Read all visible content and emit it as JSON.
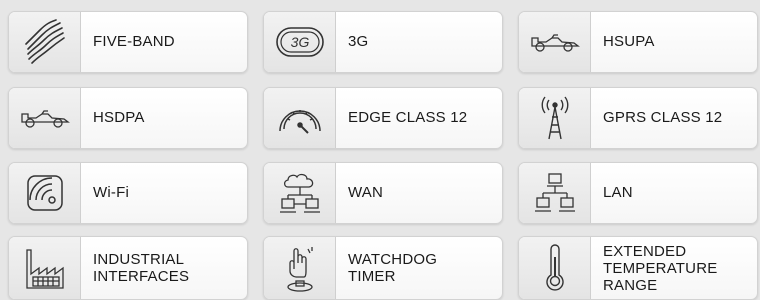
{
  "tiles": [
    {
      "label": "FIVE-BAND",
      "icon": "five-band-icon"
    },
    {
      "label": "3G",
      "icon": "3g-icon"
    },
    {
      "label": "HSUPA",
      "icon": "race-car-icon"
    },
    {
      "label": "HSDPA",
      "icon": "race-car-icon"
    },
    {
      "label": "EDGE CLASS 12",
      "icon": "speedometer-icon"
    },
    {
      "label": "GPRS CLASS 12",
      "icon": "antenna-tower-icon"
    },
    {
      "label": "Wi-Fi",
      "icon": "wifi-icon"
    },
    {
      "label": "WAN",
      "icon": "cloud-network-icon"
    },
    {
      "label": "LAN",
      "icon": "lan-network-icon"
    },
    {
      "label": "INDUSTRIAL\nINTERFACES",
      "icon": "factory-icon"
    },
    {
      "label": "WATCHDOG\nTIMER",
      "icon": "hand-button-icon"
    },
    {
      "label": "EXTENDED\nTEMPERATURE\nRANGE",
      "icon": "thermometer-icon"
    }
  ],
  "icon_text": {
    "three_g": "3G"
  }
}
